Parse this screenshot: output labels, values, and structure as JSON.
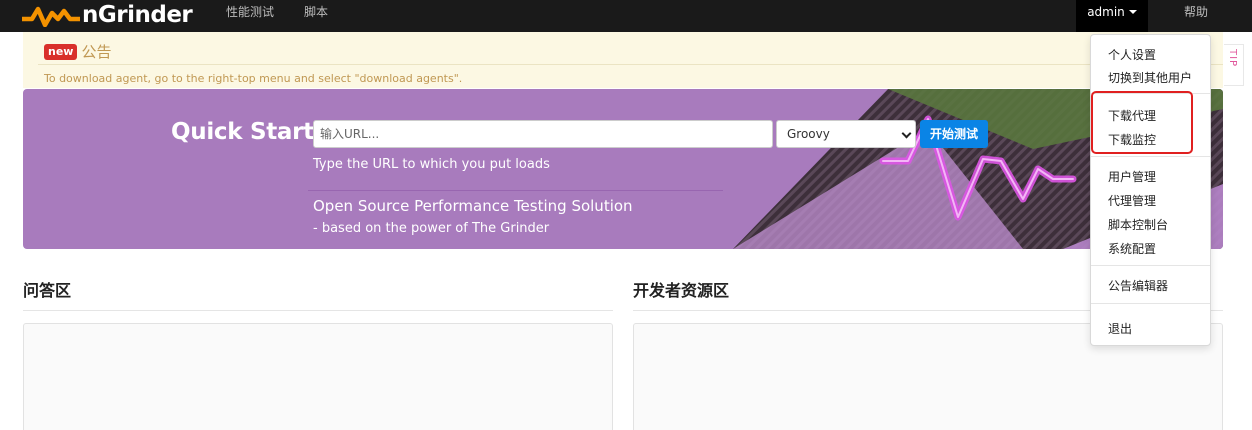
{
  "app": {
    "logo_text": "nGrinder",
    "brand_color": "#f39200"
  },
  "nav": {
    "items": [
      {
        "label": "性能测试"
      },
      {
        "label": "脚本"
      }
    ],
    "user": "admin",
    "help": "帮助"
  },
  "notice": {
    "badge": "new",
    "title": "公告",
    "text": "To download agent, go to the right-top menu and select \"download agents\"."
  },
  "tip": {
    "label": "TIP"
  },
  "quick_start": {
    "title": "Quick Start",
    "url_placeholder": "输入URL...",
    "script_type": "Groovy",
    "start_label": "开始测试",
    "subtitle": "Type the URL to which you put loads",
    "headline": "Open Source Performance Testing Solution",
    "tagline": "- based on the power of The Grinder"
  },
  "sections": {
    "qa_title": "问答区",
    "dev_title": "开发者资源区"
  },
  "user_menu": {
    "personal_settings": "个人设置",
    "switch_user": "切换到其他用户",
    "download_agent": "下载代理",
    "download_monitor": "下载监控",
    "user_management": "用户管理",
    "agent_management": "代理管理",
    "script_console": "脚本控制台",
    "system_config": "系统配置",
    "notice_editor": "公告编辑器",
    "logout": "退出"
  },
  "colors": {
    "nav_bg": "#1a1a1a",
    "hero_bg": "#a87bbd",
    "notice_bg": "#fcf8e3",
    "primary_button": "#0a84e6",
    "highlight_border": "#e02020"
  }
}
